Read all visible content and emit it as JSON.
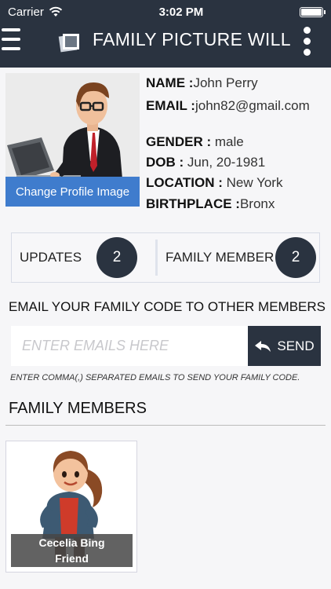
{
  "status_bar": {
    "carrier": "Carrier",
    "time": "3:02 PM"
  },
  "nav": {
    "title": "FAMILY PICTURE WILL"
  },
  "profile": {
    "change_image_label": "Change Profile Image",
    "name_label": "NAME :",
    "name": "John Perry",
    "email_label": "EMAIL :",
    "email": "john82@gmail.com",
    "gender_label": "GENDER :",
    "gender": "male",
    "dob_label": "DOB :",
    "dob": "Jun, 20-1981",
    "location_label": "LOCATION :",
    "location": "New York",
    "birthplace_label": "BIRTHPLACE :",
    "birthplace": "Bronx"
  },
  "counters": {
    "updates_label": "UPDATES",
    "updates_count": "2",
    "family_label": "FAMILY MEMBER",
    "family_count": "2"
  },
  "email_section": {
    "title": "EMAIL YOUR FAMILY CODE TO OTHER MEMBERS",
    "placeholder": "ENTER EMAILS HERE",
    "send_label": "SEND",
    "hint": "ENTER COMMA(,) SEPARATED EMAILS TO SEND YOUR FAMILY CODE."
  },
  "family": {
    "title": "FAMILY MEMBERS",
    "members": [
      {
        "name": "Cecelia Bing",
        "relation": "Friend"
      }
    ]
  },
  "colors": {
    "navbar": "#2a3340",
    "accent_blue": "#3f7ccd",
    "background": "#f6f6f8"
  }
}
